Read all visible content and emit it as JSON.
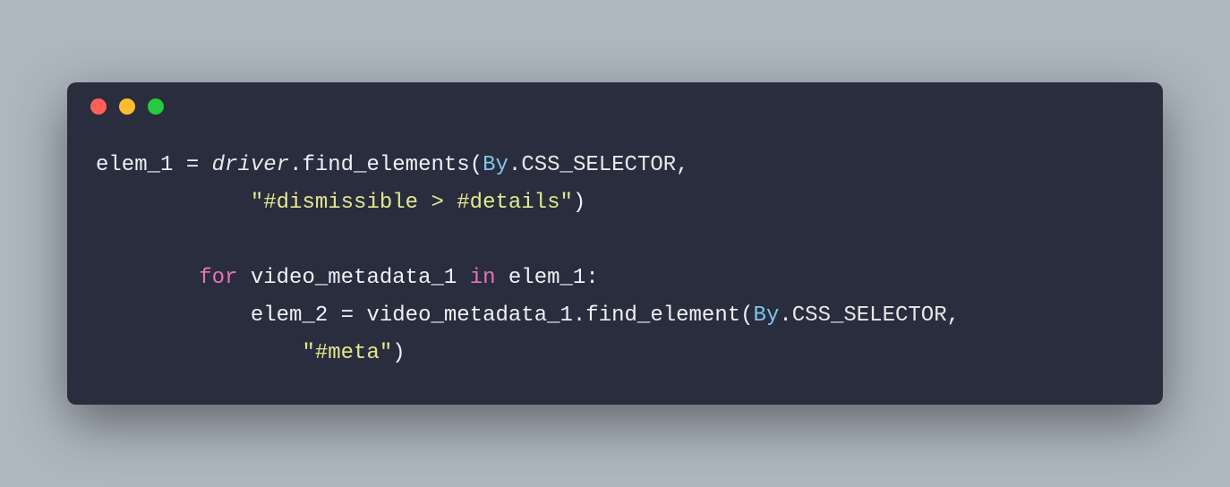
{
  "window": {
    "controls": [
      "close",
      "minimize",
      "zoom"
    ]
  },
  "code": {
    "tokens": [
      {
        "t": "elem_1 ",
        "c": "tok-default"
      },
      {
        "t": "=",
        "c": "tok-default"
      },
      {
        "t": " ",
        "c": "tok-default"
      },
      {
        "t": "driver",
        "c": "tok-italic"
      },
      {
        "t": ".find_elements(",
        "c": "tok-default"
      },
      {
        "t": "By",
        "c": "tok-member"
      },
      {
        "t": ".",
        "c": "tok-default"
      },
      {
        "t": "CSS_SELECTOR",
        "c": "tok-const"
      },
      {
        "t": ",",
        "c": "tok-default"
      },
      {
        "t": "\n            ",
        "c": "tok-default"
      },
      {
        "t": "\"#dismissible > #details\"",
        "c": "tok-string"
      },
      {
        "t": ")",
        "c": "tok-default"
      },
      {
        "t": "\n\n        ",
        "c": "tok-default"
      },
      {
        "t": "for",
        "c": "tok-keyword"
      },
      {
        "t": " video_metadata_1 ",
        "c": "tok-default"
      },
      {
        "t": "in",
        "c": "tok-keyword"
      },
      {
        "t": " elem_1:",
        "c": "tok-default"
      },
      {
        "t": "\n            elem_2 ",
        "c": "tok-default"
      },
      {
        "t": "=",
        "c": "tok-default"
      },
      {
        "t": " video_metadata_1.find_element(",
        "c": "tok-default"
      },
      {
        "t": "By",
        "c": "tok-member"
      },
      {
        "t": ".",
        "c": "tok-default"
      },
      {
        "t": "CSS_SELECTOR",
        "c": "tok-const"
      },
      {
        "t": ",",
        "c": "tok-default"
      },
      {
        "t": "\n                ",
        "c": "tok-default"
      },
      {
        "t": "\"#meta\"",
        "c": "tok-string"
      },
      {
        "t": ")",
        "c": "tok-default"
      }
    ]
  }
}
